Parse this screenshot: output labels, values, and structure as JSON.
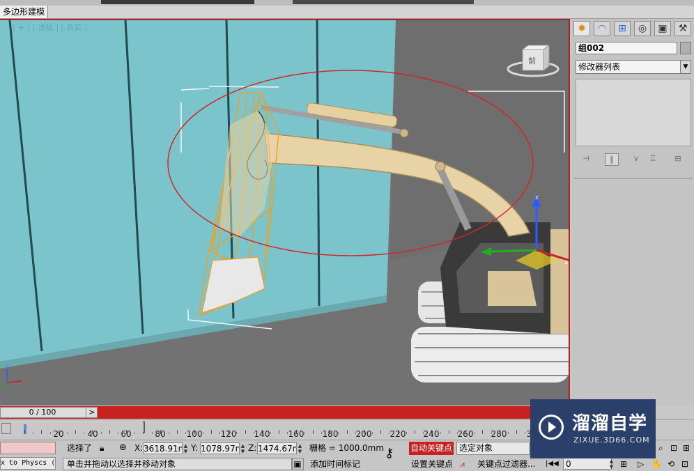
{
  "ribbon": {
    "active_tab": "多边形建模"
  },
  "viewport": {
    "label": "[ + ] [ 透视 ] [ 真实 ]",
    "viewcube_face": "前",
    "axis_x": "x",
    "axis_y": "y",
    "axis_z": "z",
    "gizmo_z": "z",
    "gizmo_x": "x"
  },
  "command_panel": {
    "object_name": "组002",
    "modifier_list": "修改器列表",
    "tab_icons": [
      "create-icon",
      "modify-icon",
      "hierarchy-icon",
      "motion-icon",
      "display-icon",
      "utilities-icon"
    ]
  },
  "time_slider": {
    "frame_text": "0 / 100",
    "next_label": ">"
  },
  "track_bar": {
    "ticks": [
      "20",
      "40",
      "60",
      "80",
      "100",
      "120",
      "140",
      "160",
      "180",
      "200",
      "220",
      "240",
      "260",
      "280",
      "30"
    ]
  },
  "status": {
    "selection": "选择了",
    "x_label": "X:",
    "x_value": "3618.91mr",
    "y_label": "Y:",
    "y_value": "1078.97mr",
    "z_label": "Z:",
    "z_value": "1474.67mr",
    "grid": "栅格 = 1000.0mm",
    "autokey": "自动关键点",
    "selected_objects": "选定对象",
    "set_key": "设置关键点",
    "key_filters": "关键点过滤器...",
    "frame_value": "0",
    "prompt": "单击并拖动以选择并移动对象",
    "add_time_tag": "添加时间标记",
    "maxscript": "x to Physcs ("
  },
  "watermark": {
    "title": "溜溜自学",
    "url": "ZIXUE.3D66.COM"
  },
  "colors": {
    "autokey_red": "#c62020",
    "wall_teal": "#7cc4cc",
    "floor_gray": "#727272",
    "excavator_tan": "#e8d3a6",
    "selection_orange": "#f0a020",
    "watermark_bg": "#2a3f6a"
  }
}
